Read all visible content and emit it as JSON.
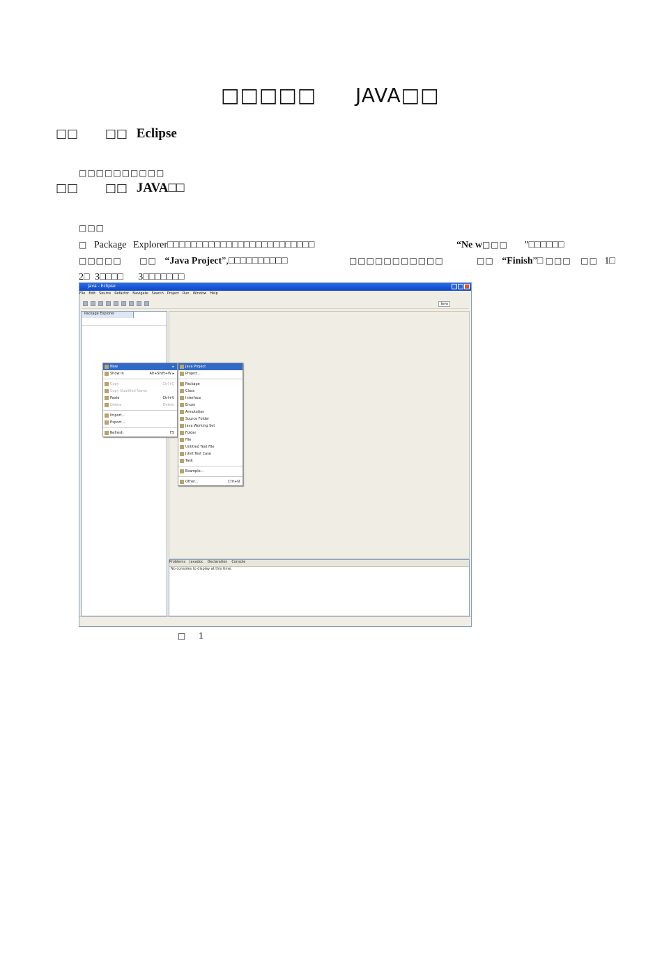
{
  "title": {
    "a": "□□□□□",
    "b": "JAVA□□"
  },
  "section1": {
    "num": "□□",
    "verb": "□□",
    "name": "Eclipse"
  },
  "overlap_text": "□□□□□□□□□□",
  "section2": {
    "num": "□□",
    "verb": "□□",
    "name": "JAVA□□"
  },
  "label": "□□□",
  "para": {
    "l1_a": "□",
    "l1_b": "Package",
    "l1_c": "Explorer□□□□□□□□□□□□□□□□□□□□□□□□□",
    "l1_d": "“Ne w",
    "l1_e": "□□□",
    "l1_f": "”□□□□□□",
    "l2_a": "□□□□□",
    "l2_b": "□□",
    "l2_c": "“Java Project",
    "l2_d": "”,□□□□□□□□□□",
    "l2_e": "□□□□□□□□□□□",
    "l2_f": "□□",
    "l2_g": "“Finish",
    "l2_h": "”□",
    "l2_i": "□□□",
    "l2_j": "□□",
    "l2_k": "1□",
    "l3_a": "2□",
    "l3_b": "3□□□□",
    "l3_c": "3□□□□□□□"
  },
  "caption": {
    "a": "□",
    "b": "1"
  },
  "screenshot": {
    "window_title": "Java - Eclipse",
    "menus": [
      "File",
      "Edit",
      "Source",
      "Refactor",
      "Navigate",
      "Search",
      "Project",
      "Run",
      "Window",
      "Help"
    ],
    "perspective": "Java",
    "pkg_tab": "Package Explorer",
    "context_menu": [
      {
        "label": "New",
        "shortcut": "▸",
        "state": "sel"
      },
      {
        "label": "Show In",
        "shortcut": "Alt+Shift+W ▸",
        "state": ""
      },
      {
        "label": "Copy",
        "shortcut": "Ctrl+C",
        "state": "dis"
      },
      {
        "label": "Copy Qualified Name",
        "shortcut": "",
        "state": "dis"
      },
      {
        "label": "Paste",
        "shortcut": "Ctrl+V",
        "state": ""
      },
      {
        "label": "Delete",
        "shortcut": "Delete",
        "state": "dis"
      },
      {
        "label": "Import...",
        "shortcut": "",
        "state": ""
      },
      {
        "label": "Export...",
        "shortcut": "",
        "state": ""
      },
      {
        "label": "Refresh",
        "shortcut": "F5",
        "state": ""
      }
    ],
    "new_submenu": [
      {
        "label": "Java Project",
        "state": "sel"
      },
      {
        "label": "Project...",
        "state": ""
      },
      {
        "label": "Package",
        "state": ""
      },
      {
        "label": "Class",
        "state": ""
      },
      {
        "label": "Interface",
        "state": ""
      },
      {
        "label": "Enum",
        "state": ""
      },
      {
        "label": "Annotation",
        "state": ""
      },
      {
        "label": "Source Folder",
        "state": ""
      },
      {
        "label": "Java Working Set",
        "state": ""
      },
      {
        "label": "Folder",
        "state": ""
      },
      {
        "label": "File",
        "state": ""
      },
      {
        "label": "Untitled Text File",
        "state": ""
      },
      {
        "label": "JUnit Test Case",
        "state": ""
      },
      {
        "label": "Task",
        "state": ""
      },
      {
        "label": "Example...",
        "state": ""
      },
      {
        "label": "Other...",
        "shortcut": "Ctrl+N",
        "state": ""
      }
    ],
    "console_tabs": [
      "Problems",
      "Javadoc",
      "Declaration",
      "Console"
    ],
    "console_msg": "No consoles to display at this time."
  }
}
